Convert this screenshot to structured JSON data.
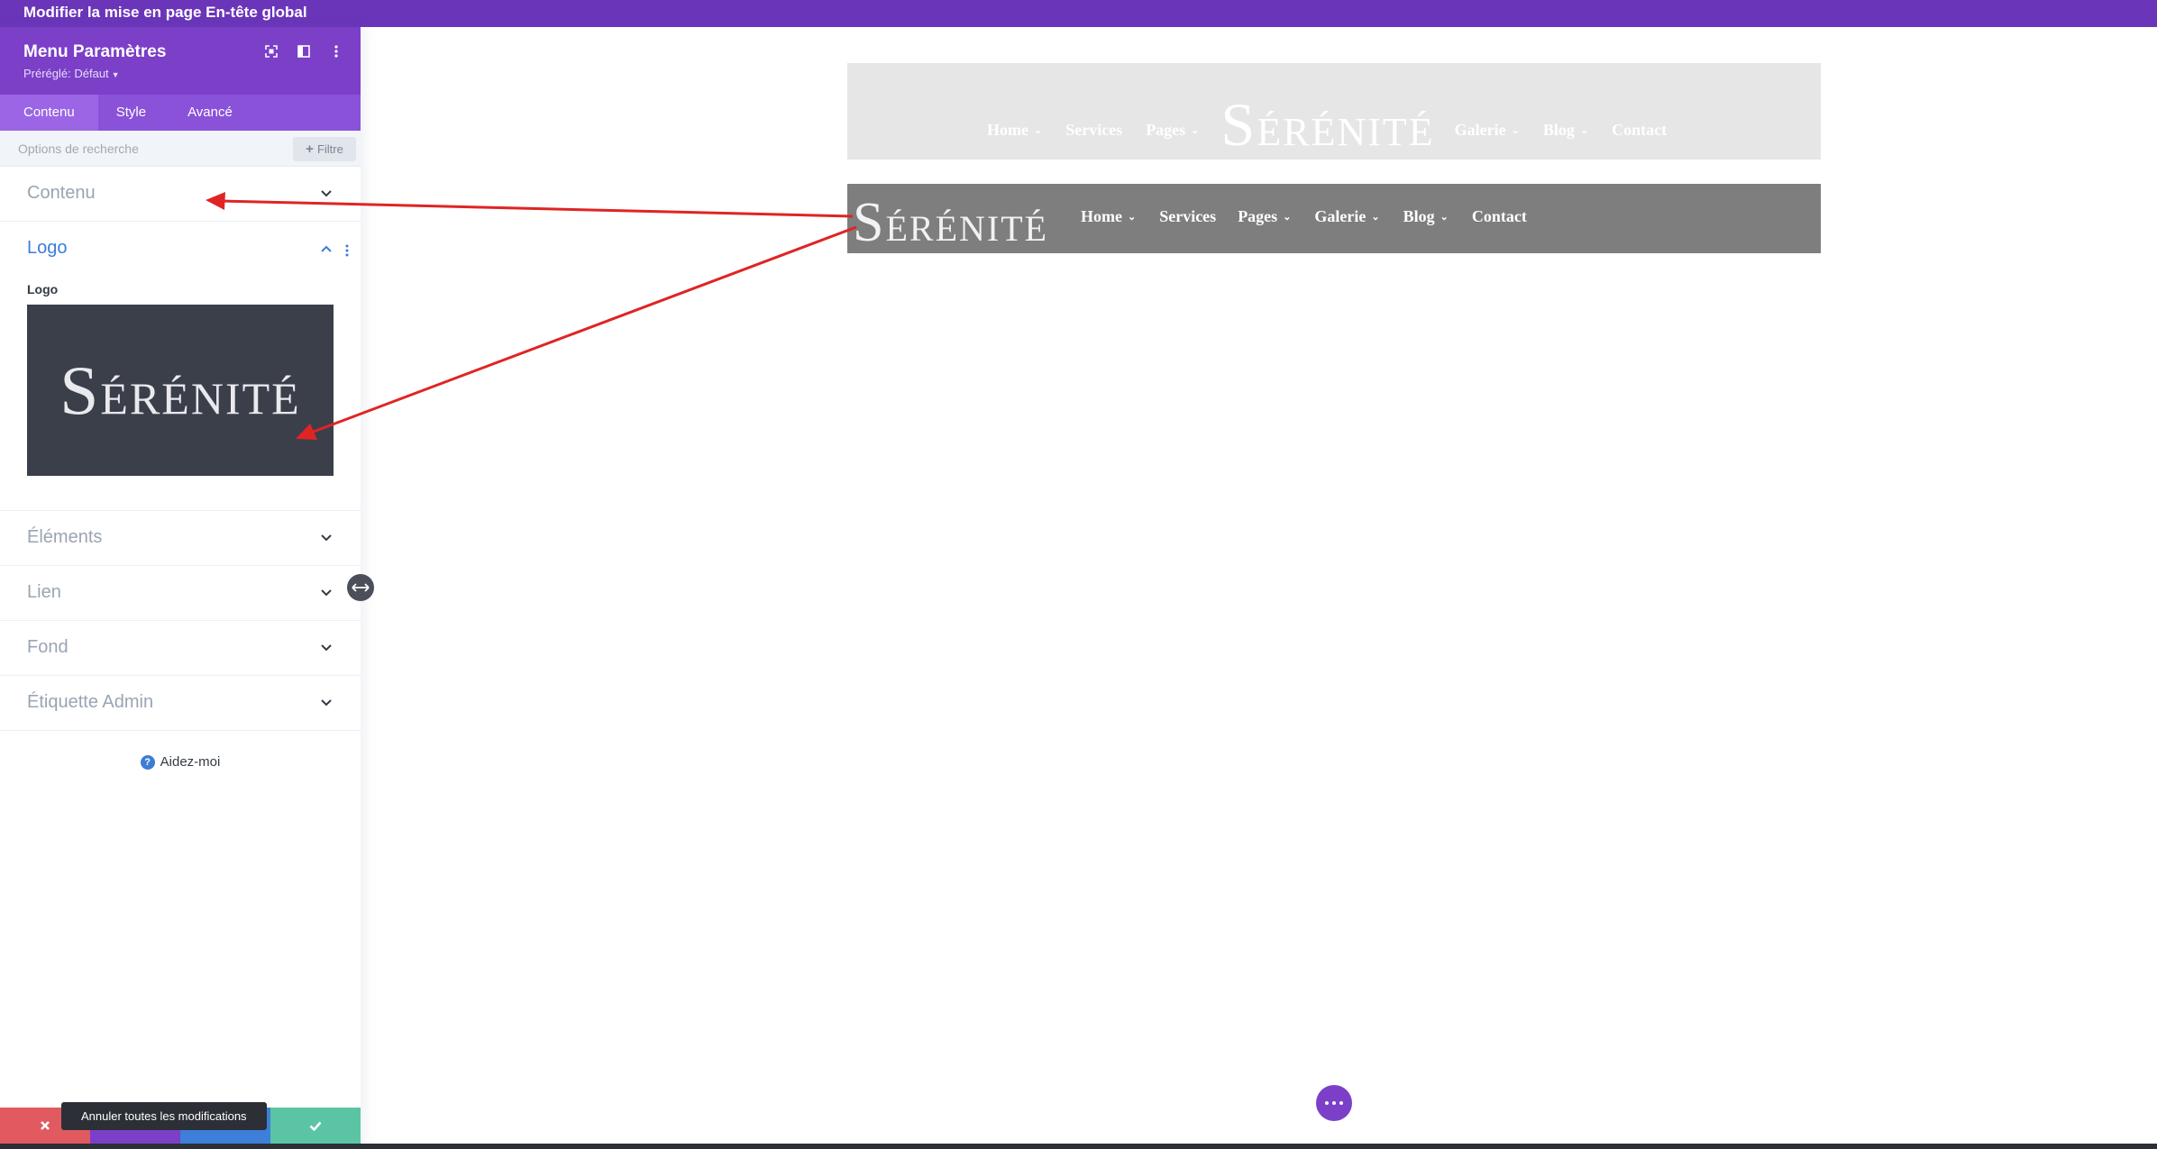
{
  "window": {
    "title": "Modifier la mise en page En-tête global"
  },
  "panel": {
    "title": "Menu Paramètres",
    "preset": "Préréglé: Défaut",
    "tabs": [
      {
        "label": "Contenu",
        "active": true
      },
      {
        "label": "Style",
        "active": false
      },
      {
        "label": "Avancé",
        "active": false
      }
    ],
    "search_placeholder": "Options de recherche",
    "filter_label": "Filtre",
    "sections": {
      "contenu": "Contenu",
      "logo": "Logo",
      "logo_field_label": "Logo",
      "elements": "Éléments",
      "lien": "Lien",
      "fond": "Fond",
      "etiquette": "Étiquette Admin"
    },
    "help": "Aidez-moi",
    "tooltip": "Annuler toutes les modifications"
  },
  "logo_text": {
    "first": "S",
    "rest": "ÉRÉNITÉ"
  },
  "preview": {
    "nav_items": [
      "Home",
      "Services",
      "Pages",
      "Galerie",
      "Blog",
      "Contact"
    ]
  },
  "colors": {
    "topbar": "#6b35ba",
    "panel_header": "#7b3fc8",
    "accent_blue": "#3c7ed6",
    "annotation_arrow": "#e02424"
  }
}
